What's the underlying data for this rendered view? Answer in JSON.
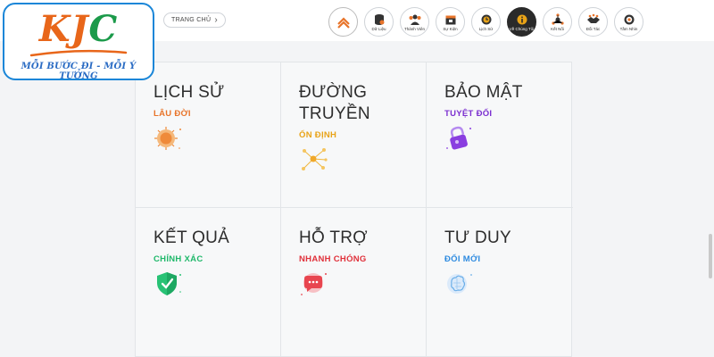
{
  "logo": {
    "k": "K",
    "j": "J",
    "c": "C",
    "slogan": "MỖI BƯỚC ĐI - MỖI Ý TƯỞNG",
    "colors": {
      "orange": "#e8661a",
      "green": "#1b9a4a",
      "blue": "#2b6cc4",
      "border": "#1a86d8"
    }
  },
  "breadcrumb": {
    "label": "TRANG CHỦ",
    "chevron": "›"
  },
  "nav": [
    {
      "label": "",
      "icon": "chevron-up-icon"
    },
    {
      "label": "Dữ Liệu",
      "icon": "database-icon"
    },
    {
      "label": "Thành Viên",
      "icon": "users-icon"
    },
    {
      "label": "Sự Kiện",
      "icon": "calendar-icon"
    },
    {
      "label": "Lịch Sử",
      "icon": "clock-icon"
    },
    {
      "label": "Về Chúng Tôi",
      "icon": "info-icon",
      "active": true
    },
    {
      "label": "Kết Nối",
      "icon": "network-icon"
    },
    {
      "label": "Đối Tác",
      "icon": "handshake-icon"
    },
    {
      "label": "Tầm Nhìn",
      "icon": "target-icon"
    }
  ],
  "features": [
    {
      "title": "LỊCH SỬ",
      "subtitle": "LÂU ĐỜI",
      "color": "#e8742a",
      "icon": "sun-icon"
    },
    {
      "title": "ĐƯỜNG TRUYỀN",
      "subtitle": "ỔN ĐỊNH",
      "color": "#e8a317",
      "icon": "network-nodes-icon"
    },
    {
      "title": "BẢO MẬT",
      "subtitle": "TUYỆT ĐỐI",
      "color": "#7b2fd0",
      "icon": "padlock-icon"
    },
    {
      "title": "KẾT QUẢ",
      "subtitle": "CHÍNH XÁC",
      "color": "#1fb86a",
      "icon": "shield-check-icon"
    },
    {
      "title": "HỖ TRỢ",
      "subtitle": "NHANH CHÓNG",
      "color": "#e0303a",
      "icon": "chat-bubble-icon"
    },
    {
      "title": "TƯ DUY",
      "subtitle": "ĐỔI MỚI",
      "color": "#2f8be0",
      "icon": "brain-icon"
    }
  ]
}
